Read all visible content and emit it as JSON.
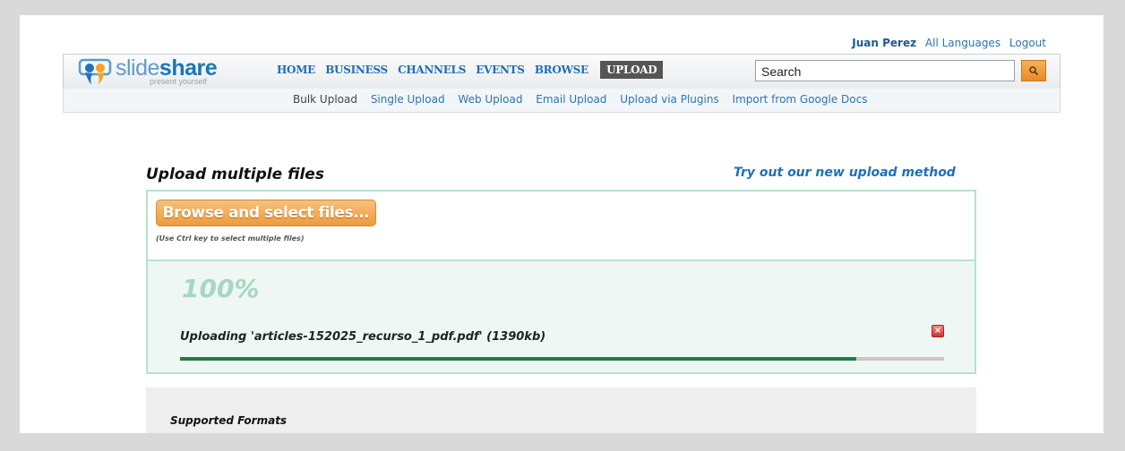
{
  "user_bar": {
    "name": "Juan Perez",
    "languages": "All Languages",
    "logout": "Logout"
  },
  "logo": {
    "word_a": "slide",
    "word_b": "share",
    "tagline": "present yourself"
  },
  "nav": {
    "items": [
      "HOME",
      "BUSINESS",
      "CHANNELS",
      "EVENTS",
      "BROWSE"
    ],
    "active": "UPLOAD"
  },
  "search": {
    "value": "Search",
    "icon": "search-icon"
  },
  "subnav": {
    "items": [
      "Bulk Upload",
      "Single Upload",
      "Web Upload",
      "Email Upload",
      "Upload via Plugins",
      "Import from Google Docs"
    ],
    "current": "Bulk Upload"
  },
  "main": {
    "title": "Upload multiple files",
    "try_link": "Try out our new upload method",
    "browse_label": "Browse and select files...",
    "hint": "(Use Ctrl key to select multiple files)"
  },
  "upload": {
    "percent": "100%",
    "status": "Uploading 'articles-152025_recurso_1_pdf.pdf' (1390kb)",
    "remove_icon": "close-icon",
    "progress_fraction": 0.885
  },
  "formats": {
    "title": "Supported Formats"
  },
  "colors": {
    "link": "#1f6fb5",
    "accent": "#ee9a3c",
    "progress": "#1f7d45",
    "percent": "#a6d7c1"
  }
}
